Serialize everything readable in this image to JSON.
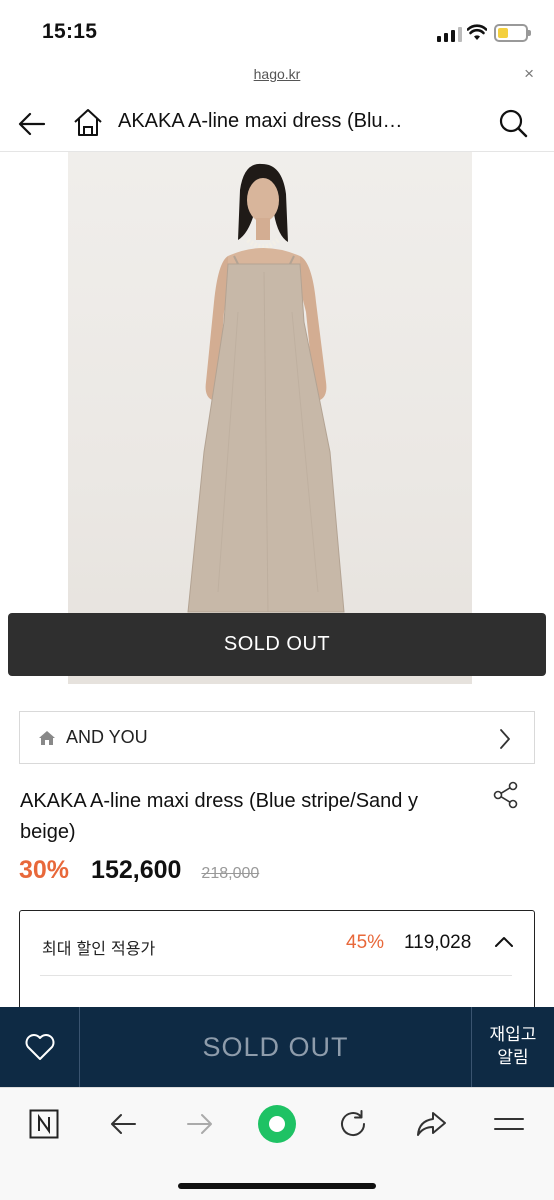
{
  "status_bar": {
    "time": "15:15",
    "battery_level": 0.4
  },
  "url_bar": {
    "domain": "hago.kr",
    "close_label": "×"
  },
  "nav": {
    "title": "AKAKA A-line maxi dress (Blu…"
  },
  "product_image": {
    "overlay_text": "SOLD OUT"
  },
  "brand": {
    "name": "AND YOU"
  },
  "product": {
    "name": "AKAKA A-line maxi dress (Blue stripe/Sand y beige)",
    "discount_rate": "30%",
    "sale_price": "152,600",
    "original_price": "218,000"
  },
  "max_discount": {
    "label": "최대 할인 적용가",
    "rate": "45%",
    "price": "119,028"
  },
  "bottom_bar": {
    "soldout_label": "SOLD OUT",
    "restock_line1": "재입고",
    "restock_line2": "알림"
  },
  "colors": {
    "accent_discount": "#e8683a",
    "bottom_bar_bg": "#0e2a44",
    "overlay_bg": "#2f2f2f",
    "browser_green": "#1ec264"
  },
  "icons": [
    "back-arrow-icon",
    "home-icon",
    "search-icon",
    "chevron-right-icon",
    "share-icon",
    "chevron-up-icon",
    "heart-icon",
    "naver-icon",
    "forward-arrow-icon",
    "browser-home-icon",
    "refresh-icon",
    "share-arrow-icon",
    "menu-icon"
  ]
}
